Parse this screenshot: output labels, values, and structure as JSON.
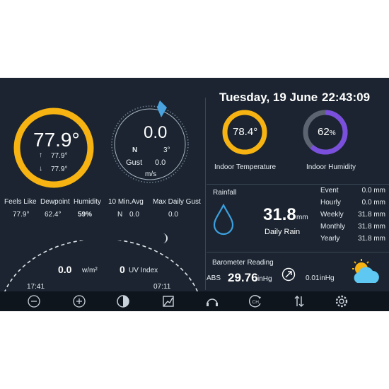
{
  "header": {
    "date": "Tuesday, 19 June",
    "time": "22:43:09"
  },
  "outdoor": {
    "temperature": "77.9°",
    "high": "77.9°",
    "low": "77.9°",
    "ring_color": "#f6b311",
    "labels": {
      "feels_like": "Feels Like",
      "dewpoint": "Dewpoint",
      "humidity": "Humidity"
    },
    "values": {
      "feels_like": "77.9°",
      "dewpoint": "62.4°",
      "humidity": "59%"
    }
  },
  "wind": {
    "speed": "0.0",
    "direction": "N",
    "degrees": "3°",
    "gust_label": "Gust",
    "gust_value": "0.0",
    "unit": "m/s",
    "avg_label": "10 Min.Avg",
    "avg_direction": "N",
    "avg_value": "0.0",
    "max_gust_label": "Max Daily Gust",
    "max_gust_value": "0.0",
    "accent_color": "#4aa3df"
  },
  "solar": {
    "radiation": "0.0",
    "radiation_unit": "w/m²",
    "uv": "0",
    "uv_label": "UV Index",
    "sunrise": "17:41",
    "sunset": "07:11"
  },
  "indoor": {
    "temperature": "78.4°",
    "temperature_label": "Indoor Temperature",
    "humidity": "62",
    "humidity_unit": "%",
    "humidity_label": "Indoor Humidity",
    "humidity_fraction": 0.62,
    "humidity_color": "#7a4fdc"
  },
  "rainfall": {
    "title": "Rainfall",
    "value": "31.8",
    "unit": "mm",
    "caption": "Daily Rain",
    "rows": [
      {
        "label": "Event",
        "value": "0.0 mm"
      },
      {
        "label": "Hourly",
        "value": "0.0 mm"
      },
      {
        "label": "Weekly",
        "value": "31.8 mm"
      },
      {
        "label": "Monthly",
        "value": "31.8 mm"
      },
      {
        "label": "Yearly",
        "value": "31.8 mm"
      }
    ],
    "drop_color": "#3ba0df"
  },
  "barometer": {
    "title": "Barometer Reading",
    "abs_label": "ABS",
    "value": "29.76",
    "unit": "inHg",
    "trend_value": "0.01",
    "trend_unit": "inHg"
  },
  "toolbar": {
    "icons": [
      "minus-icon",
      "plus-icon",
      "contrast-icon",
      "graph-icon",
      "headset-icon",
      "channel-icon",
      "sort-icon",
      "gear-icon"
    ],
    "channel_text": "CH"
  }
}
